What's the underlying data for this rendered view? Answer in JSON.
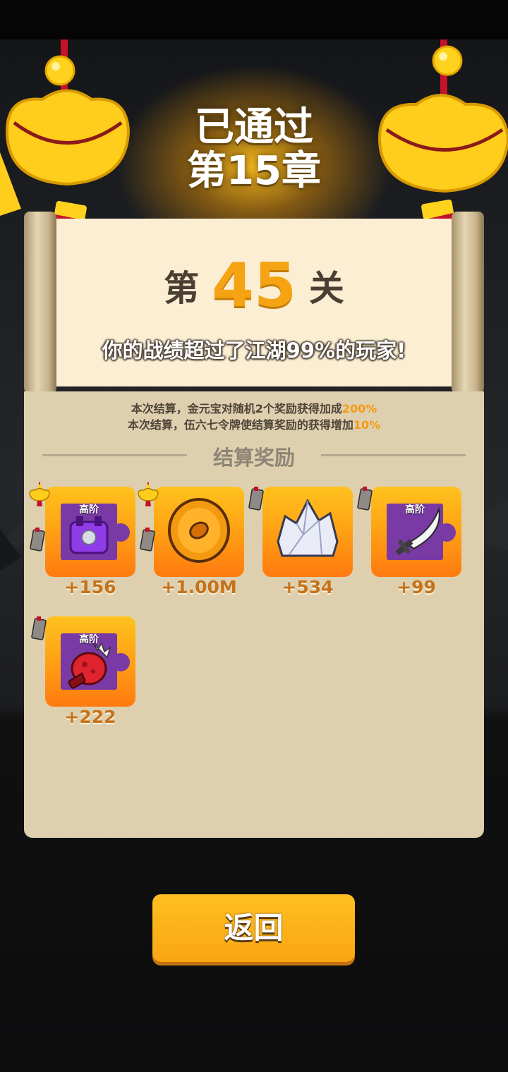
{
  "header": {
    "title_line1": "已通过",
    "title_line2": "第15章"
  },
  "level": {
    "prefix": "第",
    "number": "45",
    "suffix": "关",
    "beat_text": "你的战绩超过了江湖99%的玩家!"
  },
  "bonus": {
    "line1_text": "本次结算，金元宝对随机2个奖励获得加成",
    "line1_value": "200%",
    "line2_text": "本次结算，伍六七令牌使结算奖励的获得增加",
    "line2_value": "10%"
  },
  "rewards": {
    "section_title": "结算奖励",
    "items": [
      {
        "icon": "purple-lock-puzzle-icon",
        "tag": "高阶",
        "count": "+156"
      },
      {
        "icon": "gold-coin-icon",
        "tag": "",
        "count": "+1.00M"
      },
      {
        "icon": "crystal-icon",
        "tag": "",
        "count": "+534"
      },
      {
        "icon": "sword-puzzle-icon",
        "tag": "高阶",
        "count": "+99"
      },
      {
        "icon": "red-glove-puzzle-icon",
        "tag": "高阶",
        "count": "+222"
      }
    ]
  },
  "buttons": {
    "back_label": "返回"
  },
  "colors": {
    "accent_orange": "#f5a312",
    "panel": "#ded0af",
    "paper": "#fbeed3",
    "button": "#ffb31a"
  }
}
